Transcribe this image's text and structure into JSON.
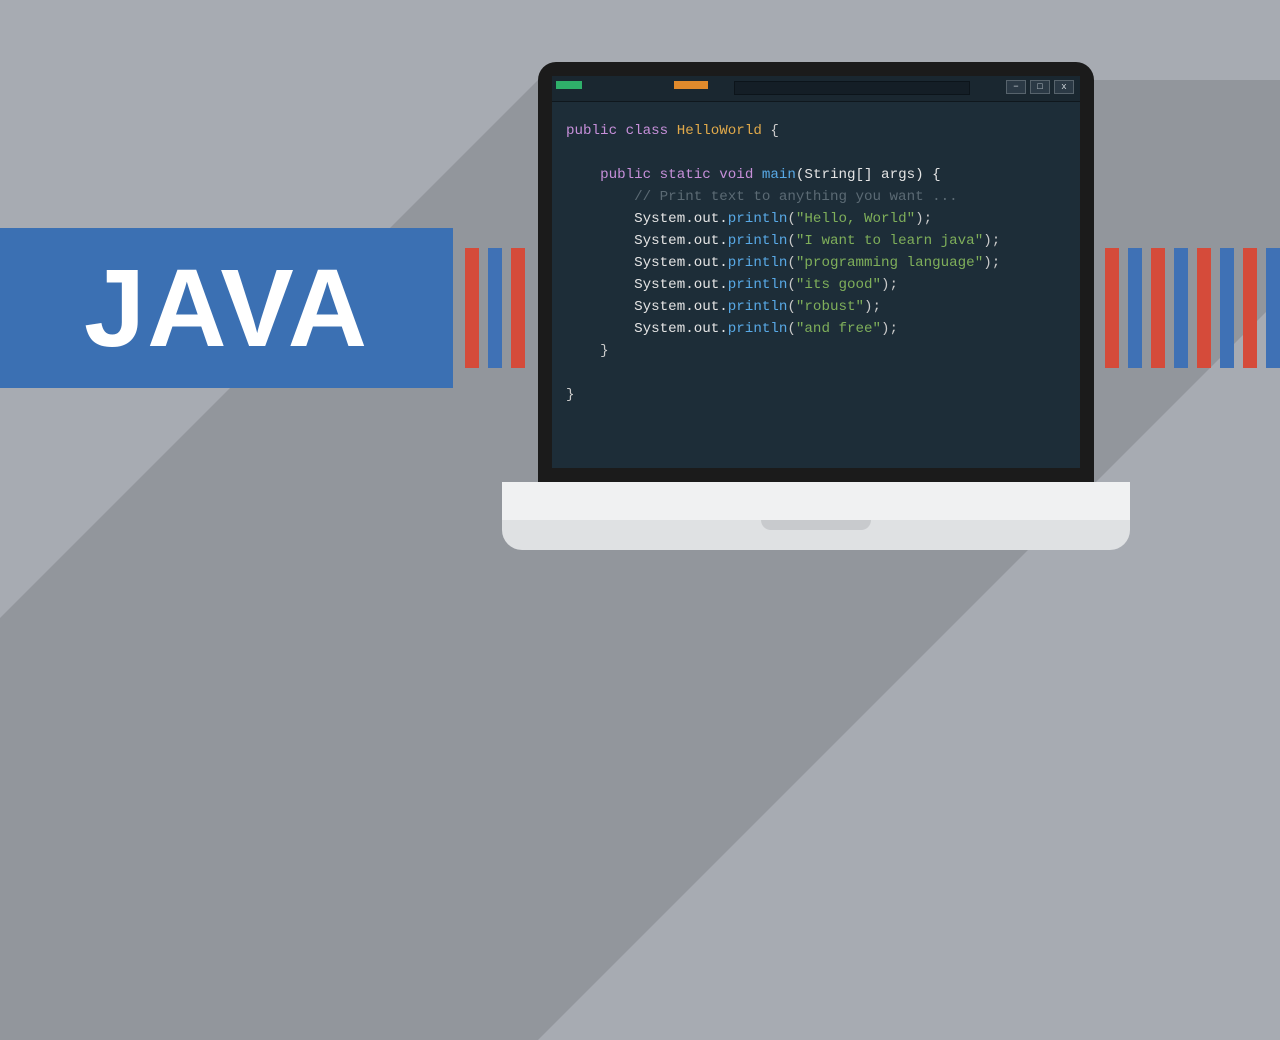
{
  "banner": {
    "title": "JAVA"
  },
  "window": {
    "controls": {
      "min": "−",
      "max": "□",
      "close": "x"
    }
  },
  "code": {
    "line1_kw1": "public",
    "line1_kw2": "class",
    "line1_cls": "HelloWorld",
    "line1_brace": " {",
    "line2_kw1": "public",
    "line2_kw2": "static",
    "line2_kw3": "void",
    "line2_fn": "main",
    "line2_args": "(String[] args) {",
    "line3_cmt": "// Print text to anything you want ...",
    "sys1": "System.out.",
    "prn1": "println",
    "paren1o": "(",
    "str1": "\"Hello, World\"",
    "paren1c": ");",
    "sys2": "System.out.",
    "prn2": "println",
    "paren2o": "(",
    "str2": "\"I want to learn java\"",
    "paren2c": ");",
    "sys3": "System.out.",
    "prn3": "println",
    "paren3o": "(",
    "str3": "\"programming language\"",
    "paren3c": ");",
    "sys4": "System.out.",
    "prn4": "println",
    "paren4o": "(",
    "str4": "\"its good\"",
    "paren4c": ");",
    "sys5": "System.out.",
    "prn5": "println",
    "paren5o": "(",
    "str5": "\"robust\"",
    "paren5c": ");",
    "sys6": "System.out.",
    "prn6": "println",
    "paren6o": "(",
    "str6": "\"and free\"",
    "paren6c": ");",
    "close_inner": "}",
    "close_outer": "}"
  }
}
